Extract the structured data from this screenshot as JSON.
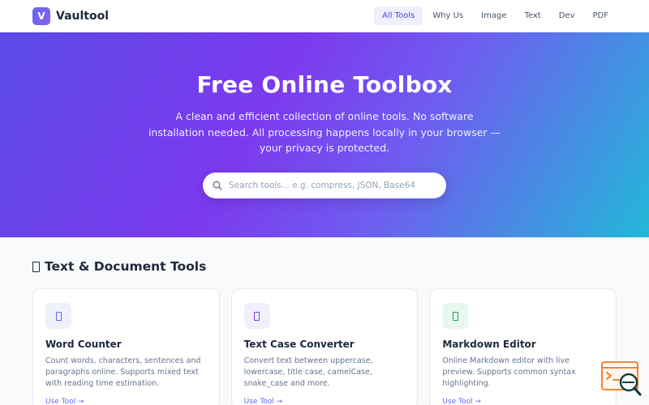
{
  "header": {
    "logo_letter": "V",
    "brand": "Vaultool",
    "nav": [
      "All Tools",
      "Why Us",
      "Image",
      "Text",
      "Dev",
      "PDF"
    ],
    "active_nav": "All Tools"
  },
  "hero": {
    "title": "Free Online Toolbox",
    "description": "A clean and efficient collection of online tools. No software installation needed. All processing happens locally in your browser — your privacy is protected.",
    "search_placeholder": "Search tools... e.g. compress, JSON, Base64",
    "search_value": ""
  },
  "section": {
    "title": "Text & Document Tools",
    "cards": [
      {
        "title": "Word Counter",
        "description": "Count words, characters, sentences and paragraphs online. Supports mixed text with reading time estimation.",
        "link": "Use Tool →",
        "icon": "document-icon",
        "accent": "#6366f1"
      },
      {
        "title": "Text Case Converter",
        "description": "Convert text between uppercase, lowercase, title case, camelCase, snake_case and more.",
        "link": "Use Tool →",
        "icon": "document-icon",
        "accent": "#7c3aed"
      },
      {
        "title": "Markdown Editor",
        "description": "Online Markdown editor with live preview. Supports common syntax highlighting.",
        "link": "Use Tool →",
        "icon": "document-icon",
        "accent": "#16a34a"
      }
    ]
  },
  "widget": {
    "icon": "code-search-icon",
    "accent": "#f97316"
  },
  "colors": {
    "brand": "#6366f1",
    "hero_gradient": [
      "#5b4ae8",
      "#7c3aed",
      "#22b8d8"
    ],
    "text": "#1e293b",
    "muted": "#64748b"
  }
}
